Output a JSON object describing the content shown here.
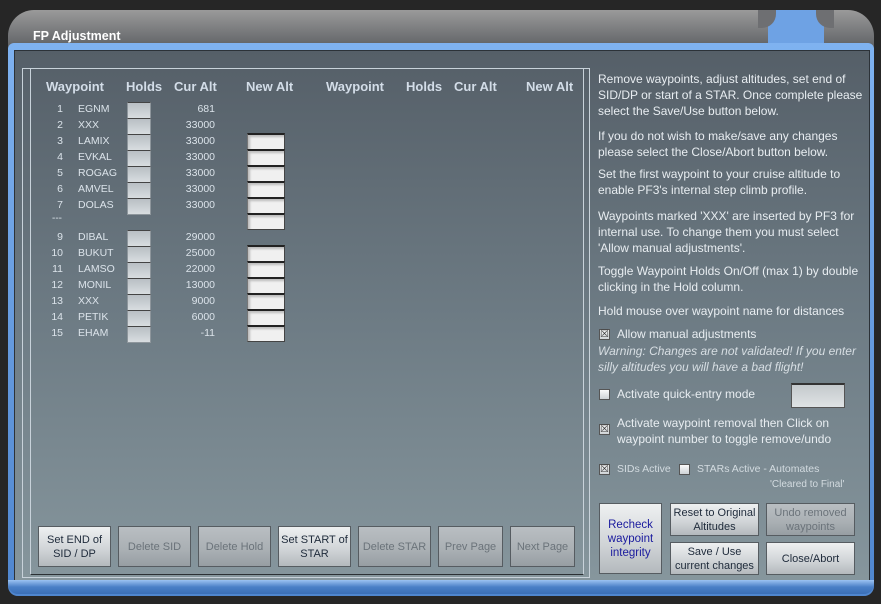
{
  "window": {
    "title": "FP Adjustment"
  },
  "table": {
    "headers_left": [
      "Waypoint",
      "Holds",
      "Cur Alt",
      "New Alt"
    ],
    "headers_right": [
      "Waypoint",
      "Holds",
      "Cur Alt",
      "New Alt"
    ],
    "separator": "---",
    "rows": [
      {
        "num": "1",
        "name": "EGNM",
        "cur_alt": "681",
        "new_alt": null
      },
      {
        "num": "2",
        "name": "XXX",
        "cur_alt": "33000",
        "new_alt": ""
      },
      {
        "num": "3",
        "name": "LAMIX",
        "cur_alt": "33000",
        "new_alt": ""
      },
      {
        "num": "4",
        "name": "EVKAL",
        "cur_alt": "33000",
        "new_alt": ""
      },
      {
        "num": "5",
        "name": "ROGAG",
        "cur_alt": "33000",
        "new_alt": ""
      },
      {
        "num": "6",
        "name": "AMVEL",
        "cur_alt": "33000",
        "new_alt": ""
      },
      {
        "num": "7",
        "name": "DOLAS",
        "cur_alt": "33000",
        "new_alt": ""
      },
      {
        "num": "9",
        "name": "DIBAL",
        "cur_alt": "29000",
        "new_alt": ""
      },
      {
        "num": "10",
        "name": "BUKUT",
        "cur_alt": "25000",
        "new_alt": ""
      },
      {
        "num": "11",
        "name": "LAMSO",
        "cur_alt": "22000",
        "new_alt": ""
      },
      {
        "num": "12",
        "name": "MONIL",
        "cur_alt": "13000",
        "new_alt": ""
      },
      {
        "num": "13",
        "name": "XXX",
        "cur_alt": "9000",
        "new_alt": ""
      },
      {
        "num": "14",
        "name": "PETIK",
        "cur_alt": "6000",
        "new_alt": ""
      },
      {
        "num": "15",
        "name": "EHAM",
        "cur_alt": "-11",
        "new_alt": null
      }
    ]
  },
  "bottom_buttons": {
    "set_end_sid": "Set END of SID / DP",
    "delete_sid": "Delete SID",
    "delete_hold": "Delete Hold",
    "set_start_star": "Set START of STAR",
    "delete_star": "Delete STAR",
    "prev_page": "Prev Page",
    "next_page": "Next Page"
  },
  "info": {
    "p1": "Remove waypoints, adjust altitudes, set end of SID/DP or start of a STAR. Once complete please select the Save/Use button below.",
    "p2": "If you do not wish to make/save any changes please select the Close/Abort button below.",
    "p3": "Set the first waypoint to your cruise altitude to enable PF3's internal step climb profile.",
    "p4": "Waypoints marked 'XXX' are inserted by PF3 for internal use. To change them you must select 'Allow manual adjustments'.",
    "p5": "Toggle Waypoint Holds On/Off (max 1) by double clicking in the Hold column.",
    "p6": "Hold mouse over waypoint name for distances"
  },
  "options": {
    "allow_manual": {
      "label": "Allow manual adjustments",
      "checked": true
    },
    "warning": "Warning: Changes are not validated! If you enter silly altitudes you will have a bad flight!",
    "quick_entry": {
      "label": "Activate quick-entry mode",
      "checked": false,
      "value": ""
    },
    "waypoint_removal": {
      "label": "Activate waypoint removal then Click on waypoint number to toggle remove/undo",
      "checked": true
    },
    "sids_active": {
      "label": "SIDs Active",
      "checked": true
    },
    "stars_active": {
      "label": "STARs Active - Automates",
      "label2": "'Cleared to Final'",
      "checked": false
    }
  },
  "action_buttons": {
    "recheck": "Recheck waypoint integrity",
    "reset": "Reset to Original Altitudes",
    "undo": "Undo removed waypoints",
    "save": "Save / Use current changes",
    "close": "Close/Abort"
  }
}
